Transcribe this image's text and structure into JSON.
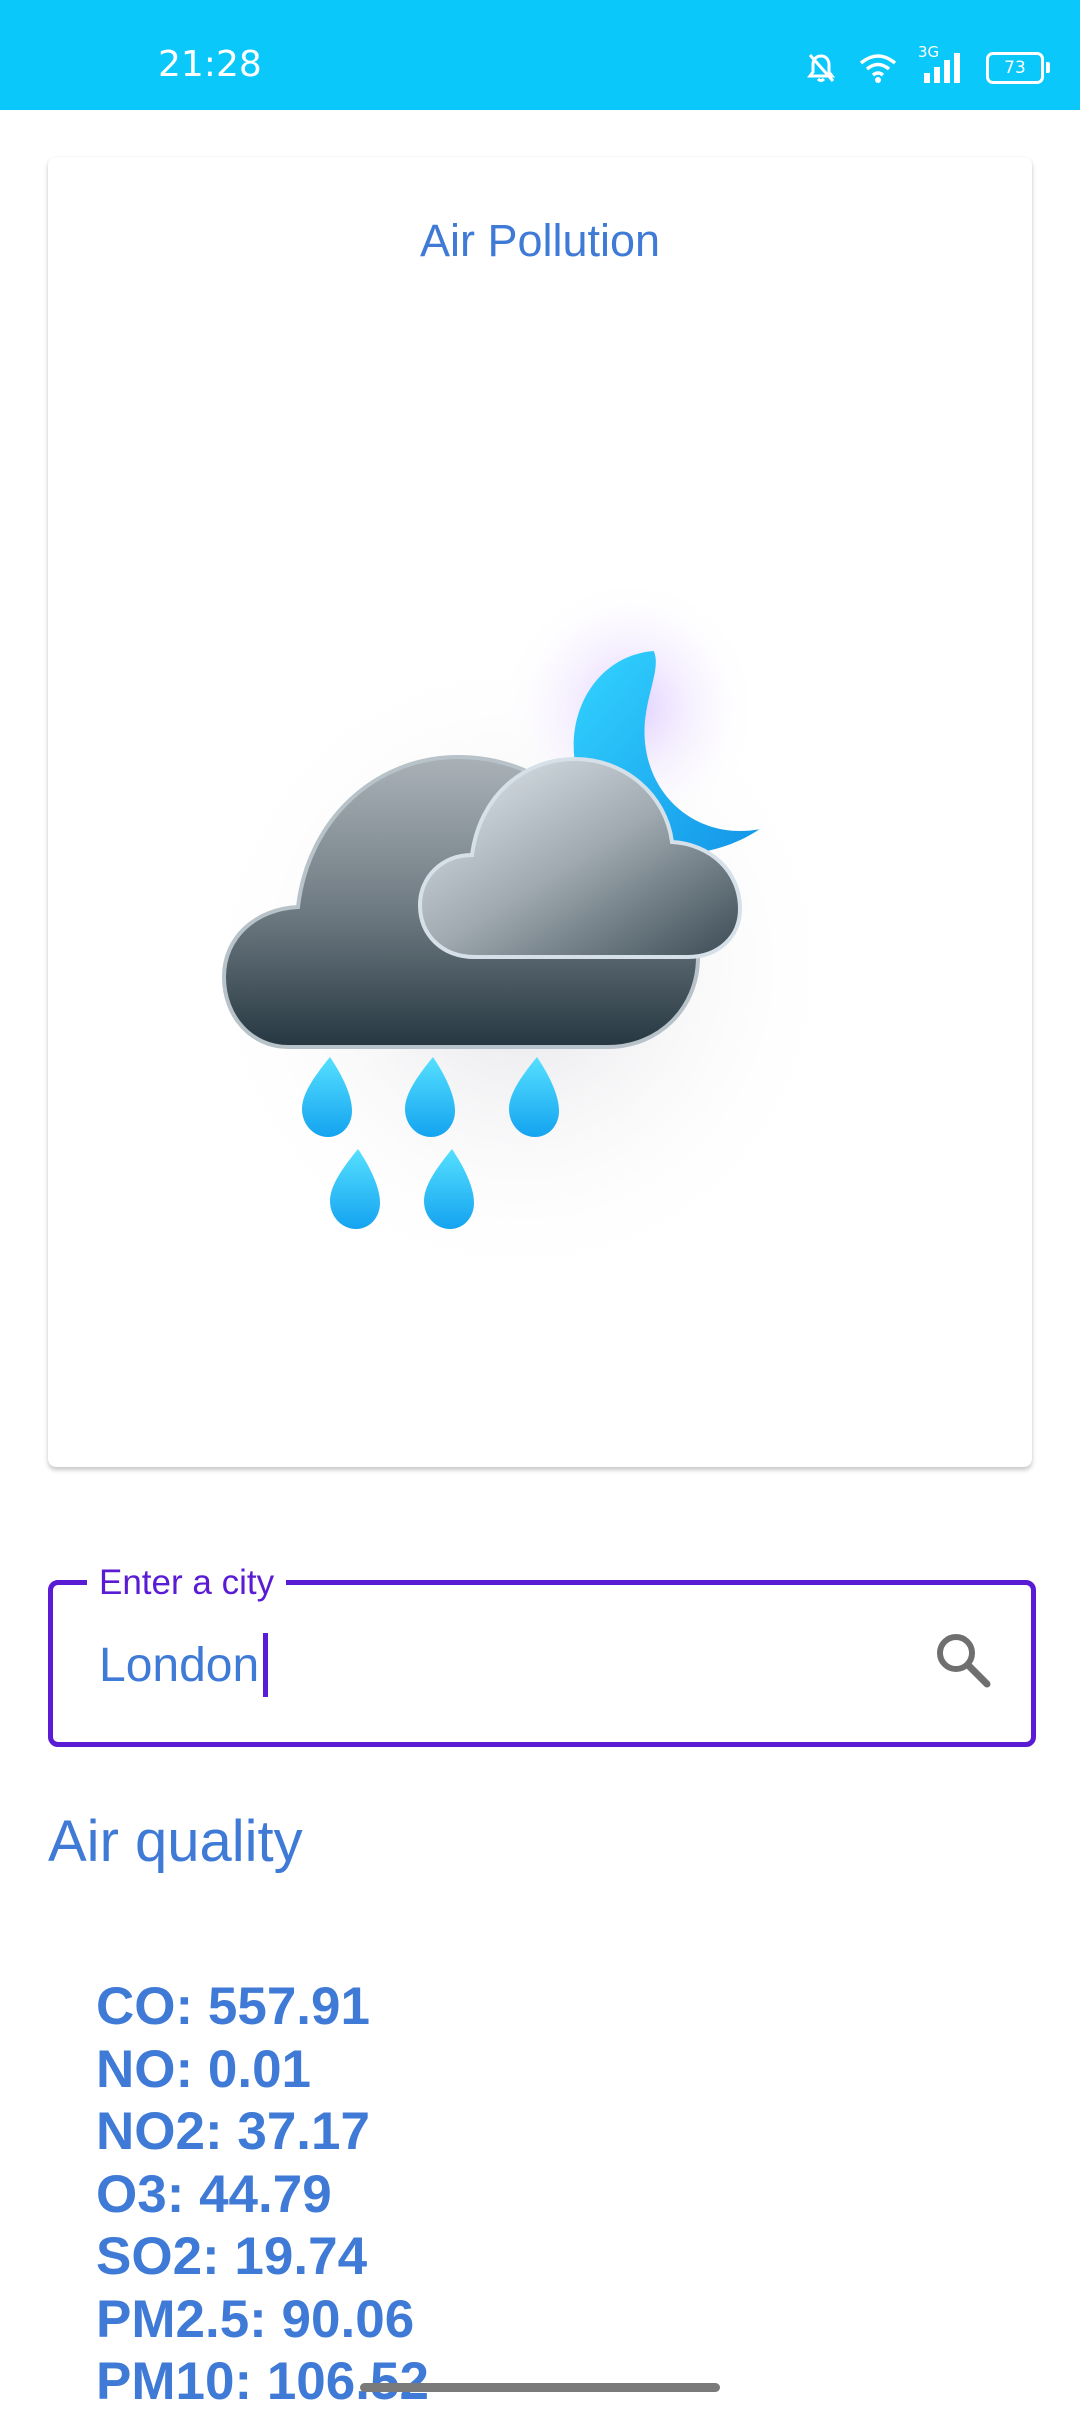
{
  "status_bar": {
    "time": "21:28",
    "network": "3G",
    "battery": "73",
    "icons": [
      "bell-off-icon",
      "wifi-icon",
      "signal-icon",
      "battery-icon"
    ]
  },
  "card": {
    "title": "Air Pollution",
    "image": "rainy-night-cloud-moon-icon"
  },
  "search": {
    "label": "Enter a city",
    "value": "London",
    "icon": "search-icon"
  },
  "air_quality": {
    "title": "Air quality",
    "readings": [
      {
        "text": "CO: 557.91"
      },
      {
        "text": "NO: 0.01"
      },
      {
        "text": "NO2: 37.17"
      },
      {
        "text": "O3: 44.79"
      },
      {
        "text": "SO2: 19.74"
      },
      {
        "text": "PM2.5: 90.06"
      },
      {
        "text": "PM10: 106.52"
      }
    ]
  },
  "colors": {
    "status_bar": "#0ac8fa",
    "accent_text": "#3f7ad6",
    "field_border": "#5a1bd4"
  }
}
